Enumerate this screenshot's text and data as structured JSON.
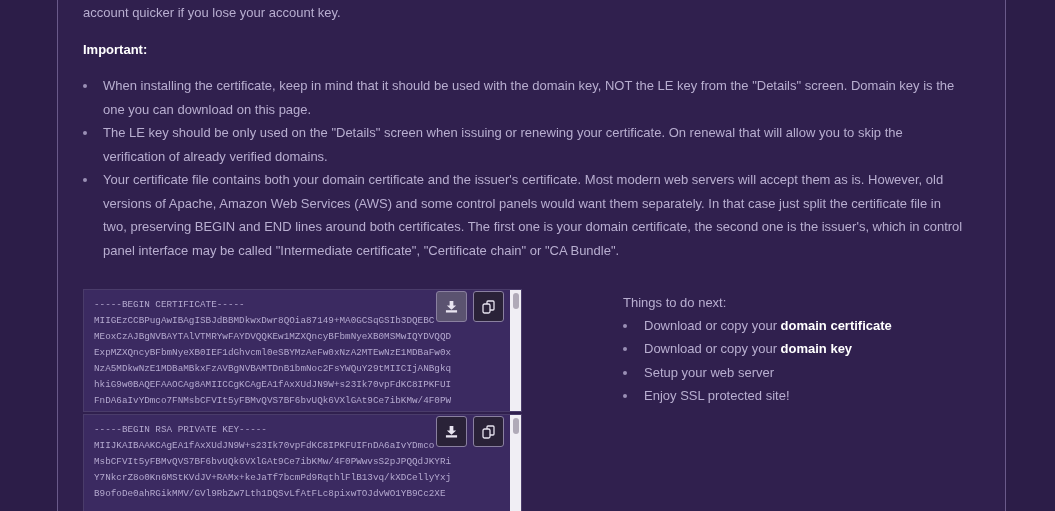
{
  "intro": "account quicker if you lose your account key.",
  "important": {
    "heading": "Important:",
    "items": [
      "When installing the certificate, keep in mind that it should be used with the domain key, NOT the LE key from the \"Details\" screen. Domain key is the one you can download on this page.",
      "The LE key should be only used on the \"Details\" screen when issuing or renewing your certificate. On renewal that will allow you to skip the verification of already verified domains.",
      "Your certificate file contains both your domain certificate and the issuer's certificate. Most modern web servers will accept them as is. However, old versions of Apache, Amazon Web Services (AWS) and some control panels would want them separately. In that case just split the certificate file in two, preserving BEGIN and END lines around both certificates. The first one is your domain certificate, the second one is the issuer's, which in control panel interface may be called \"Intermediate certificate\", \"Certificate chain\" or \"CA Bundle\"."
    ]
  },
  "files": [
    {
      "kind": "certificate",
      "download_hovered": true,
      "lines": [
        "-----BEGIN CERTIFICATE-----",
        "MIIGEzCCBPugAwIBAgISBJdBBMDkwxDwr8QOia87149+MA0GCSqGSIb3DQEBC",
        "MEoxCzAJBgNVBAYTAlVTMRYwFAYDVQQKEw1MZXQncyBFbmNyeXB0MSMwIQYDVQQD",
        "ExpMZXQncyBFbmNyeXB0IEF1dGhvcml0eSBYMzAeFw0xNzA2MTEwNzE1MDBaFw0x",
        "NzA5MDkwNzE1MDBaMBkxFzAVBgNVBAMTDnB1bmNoc2FsYWQuY29tMIICIjANBgkq",
        "hkiG9w0BAQEFAAOCAg8AMIICCgKCAgEA1fAxXUdJN9W+s23Ik70vpFdKC8IPKFUI",
        "FnDA6aIvYDmco7FNMsbCFVIt5yFBMvQVS7BF6bvUQk6VXlGAt9Ce7ibKMw/4F0PW"
      ]
    },
    {
      "kind": "key",
      "download_hovered": false,
      "lines": [
        "-----BEGIN RSA PRIVATE KEY-----",
        "MIIJKAIBAAKCAgEA1fAxXUdJN9W+s23Ik70vpFdKC8IPKFUIFnDA6aIvYDmco",
        "MsbCFVIt5yFBMvQVS7BF6bvUQk6VXlGAt9Ce7ibKMw/4F0PWwvsS2pJPQQdJKYRi",
        "Y7NkcrZ8o0Kn6MStKVdJV+RAMx+keJaTf7bcmPd9RqthlFlB13vq/kXDCellyYxj",
        "B9ofoDe0ahRGikMMV/GVl9RbZw7Lth1DQSvLfAtFLc8pixwTOJdvWO1YB9Cc2XE"
      ]
    }
  ],
  "next_steps": {
    "title": "Things to do next:",
    "items": [
      "Download or copy your **domain certificate**",
      "Download or copy your **domain key**",
      "Setup your web server",
      "Enjoy SSL protected site!"
    ]
  }
}
